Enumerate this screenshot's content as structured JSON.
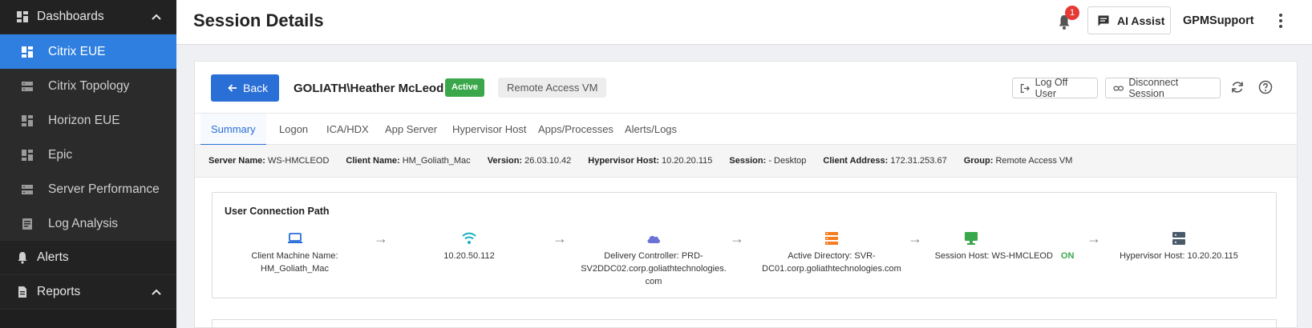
{
  "sidebar": {
    "dashboards_label": "Dashboards",
    "items": [
      {
        "label": "Citrix EUE"
      },
      {
        "label": "Citrix Topology"
      },
      {
        "label": "Horizon EUE"
      },
      {
        "label": "Epic"
      },
      {
        "label": "Server Performance"
      },
      {
        "label": "Log Analysis"
      }
    ],
    "alerts_label": "Alerts",
    "reports_label": "Reports"
  },
  "header": {
    "title": "Session Details",
    "notification_count": "1",
    "ai_assist_label": "AI Assist",
    "user_name": "GPMSupport"
  },
  "session": {
    "back_label": "Back",
    "user": "GOLIATH\\Heather McLeod",
    "status": "Active",
    "group_badge": "Remote Access VM",
    "log_off_label": "Log Off User",
    "disconnect_label": "Disconnect Session"
  },
  "tabs": [
    "Summary",
    "Logon",
    "ICA/HDX",
    "App Server",
    "Hypervisor Host",
    "Apps/Processes",
    "Alerts/Logs"
  ],
  "info": [
    {
      "label": "Server Name:",
      "value": "WS-HMCLEOD"
    },
    {
      "label": "Client Name:",
      "value": "HM_Goliath_Mac"
    },
    {
      "label": "Version:",
      "value": "26.03.10.42"
    },
    {
      "label": "Hypervisor Host:",
      "value": "10.20.20.115"
    },
    {
      "label": "Session:",
      "value": "- Desktop"
    },
    {
      "label": "Client Address:",
      "value": "172.31.253.67"
    },
    {
      "label": "Group:",
      "value": "Remote Access VM"
    }
  ],
  "connection_path": {
    "title": "User Connection Path",
    "nodes": [
      {
        "icon": "laptop-icon",
        "line1": "Client Machine Name:",
        "line2": "HM_Goliath_Mac",
        "line3": "",
        "color": "#2a6fd6"
      },
      {
        "icon": "wifi-icon",
        "line1": "10.20.50.112",
        "line2": "",
        "line3": "",
        "color": "#1ab0c0"
      },
      {
        "icon": "cloud-icon",
        "line1": "Delivery Controller: PRD-",
        "line2": "SV2DDC02.corp.goliathtechnologies.",
        "line3": "com",
        "color": "#6b72d6"
      },
      {
        "icon": "list-icon",
        "line1": "Active Directory: SVR-",
        "line2": "DC01.corp.goliathtechnologies.com",
        "line3": "",
        "color": "#f57c1f"
      },
      {
        "icon": "monitor-icon",
        "line1": "Session Host: WS-HMCLEOD",
        "line2": "",
        "line3": "",
        "color": "#3aa84a",
        "state": "ON"
      },
      {
        "icon": "server-icon",
        "line1": "Hypervisor Host: 10.20.20.115",
        "line2": "",
        "line3": "",
        "color": "#4a5a6a"
      }
    ],
    "arrow": "→"
  }
}
